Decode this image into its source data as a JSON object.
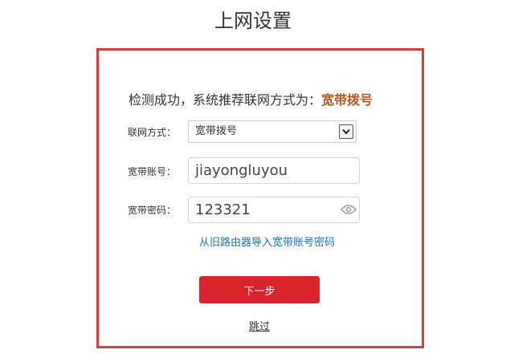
{
  "page": {
    "title": "上网设置"
  },
  "detection": {
    "message": "检测成功，系统推荐联网方式为：",
    "recommended": "宽带拨号"
  },
  "form": {
    "connection_type": {
      "label": "联网方式：",
      "value": "宽带拨号"
    },
    "account": {
      "label": "宽带账号：",
      "value": "jiayongluyou"
    },
    "password": {
      "label": "宽带密码：",
      "value": "123321"
    }
  },
  "actions": {
    "import_link": "从旧路由器导入宽带账号密码",
    "next_label": "下一步",
    "skip_label": "跳过"
  },
  "colors": {
    "frame_border": "#e03a3a",
    "highlight": "#b9571f",
    "link": "#1f6fb0",
    "primary_button": "#d8232a"
  }
}
